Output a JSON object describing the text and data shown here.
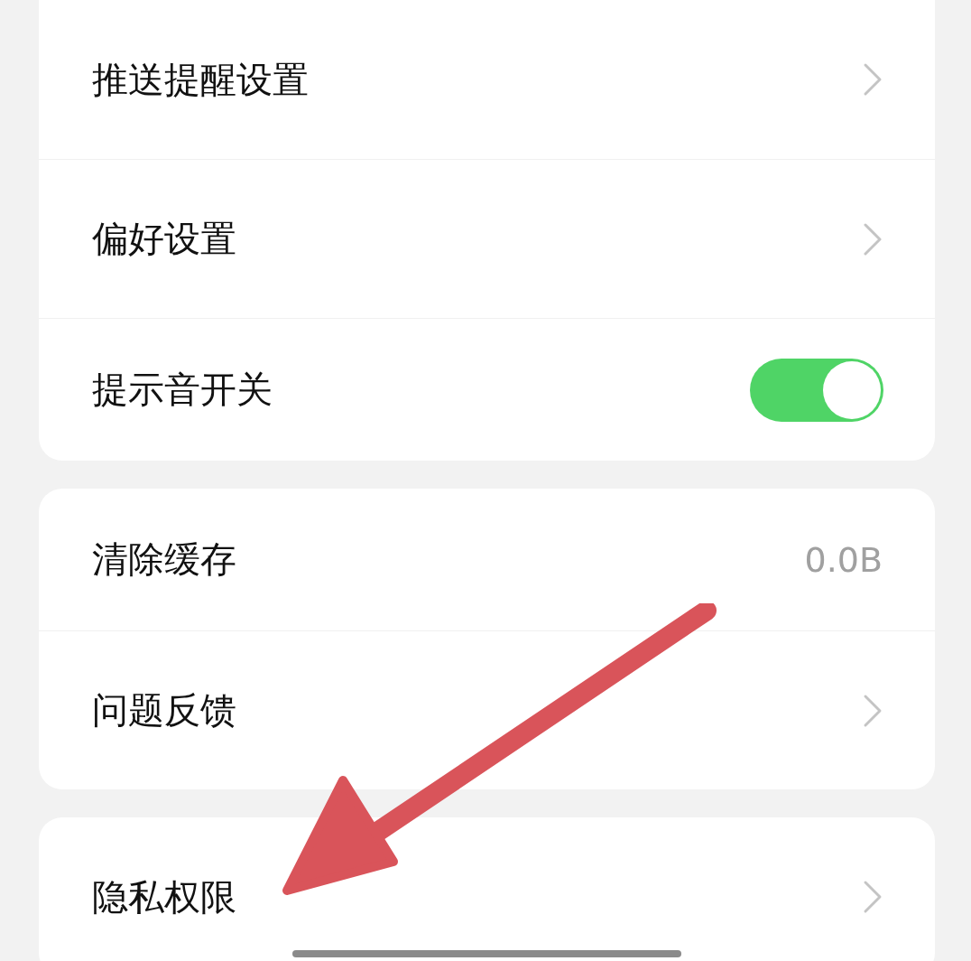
{
  "groups": [
    {
      "items": [
        {
          "kind": "link",
          "label": "推送提醒设置"
        },
        {
          "kind": "link",
          "label": "偏好设置"
        },
        {
          "kind": "toggle",
          "label": "提示音开关",
          "on": true
        }
      ]
    },
    {
      "items": [
        {
          "kind": "value",
          "label": "清除缓存",
          "value": "0.0B"
        },
        {
          "kind": "link",
          "label": "问题反馈"
        }
      ]
    },
    {
      "items": [
        {
          "kind": "link",
          "label": "隐私权限"
        }
      ]
    }
  ]
}
